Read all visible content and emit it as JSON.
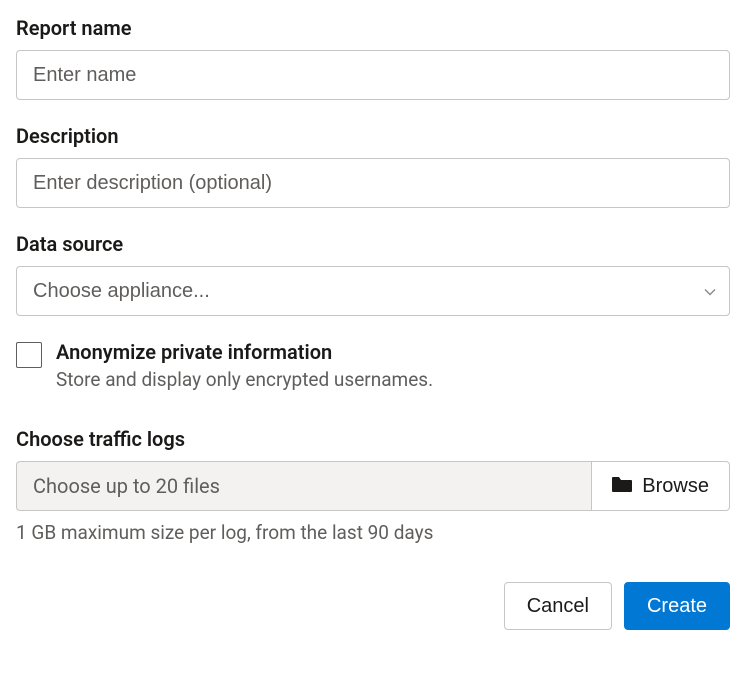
{
  "fields": {
    "reportName": {
      "label": "Report name",
      "placeholder": "Enter name",
      "value": ""
    },
    "description": {
      "label": "Description",
      "placeholder": "Enter description (optional)",
      "value": ""
    },
    "dataSource": {
      "label": "Data source",
      "placeholder": "Choose appliance..."
    },
    "anonymize": {
      "label": "Anonymize private information",
      "description": "Store and display only encrypted usernames.",
      "checked": false
    },
    "trafficLogs": {
      "label": "Choose traffic logs",
      "placeholder": "Choose up to 20 files",
      "browseLabel": "Browse",
      "hint": "1 GB maximum size per log, from the last 90 days"
    }
  },
  "actions": {
    "cancel": "Cancel",
    "create": "Create"
  }
}
